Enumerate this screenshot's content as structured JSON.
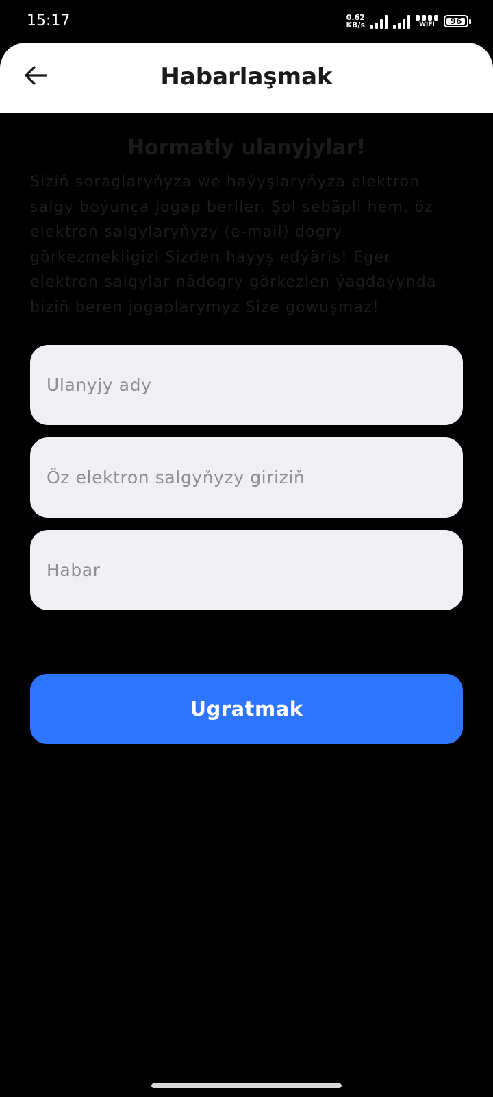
{
  "status_bar": {
    "time": "15:17",
    "net_speed_value": "0.62",
    "net_speed_unit": "KB/s",
    "wifi_label": "WIFI",
    "battery": "96"
  },
  "header": {
    "title": "Habarlaşmak",
    "back_icon": "arrow-left-icon"
  },
  "intro": {
    "title": "Hormatly ulanyjylar!",
    "text": "Siziň soraglaryňyza we haýyşlaryňyza elektron salgy boýunça jogap beriler. Şol sebäpli hem, öz elektron salgylaryňyzy (e-mail) dogry görkezmekligizi Sizden haýyş edýäris! Eger elektron salgylar nädogry görkezlen ýagdaýynda biziň beren jogaplarymyz Size gowuşmaz!"
  },
  "form": {
    "name_placeholder": "Ulanyjy ady",
    "email_placeholder": "Öz elektron salgyňyzy giriziň",
    "message_placeholder": "Habar",
    "submit_label": "Ugratmak"
  },
  "colors": {
    "accent": "#2d74ff",
    "field_bg": "#efeff4",
    "background": "#000000",
    "header_bg": "#ffffff"
  }
}
